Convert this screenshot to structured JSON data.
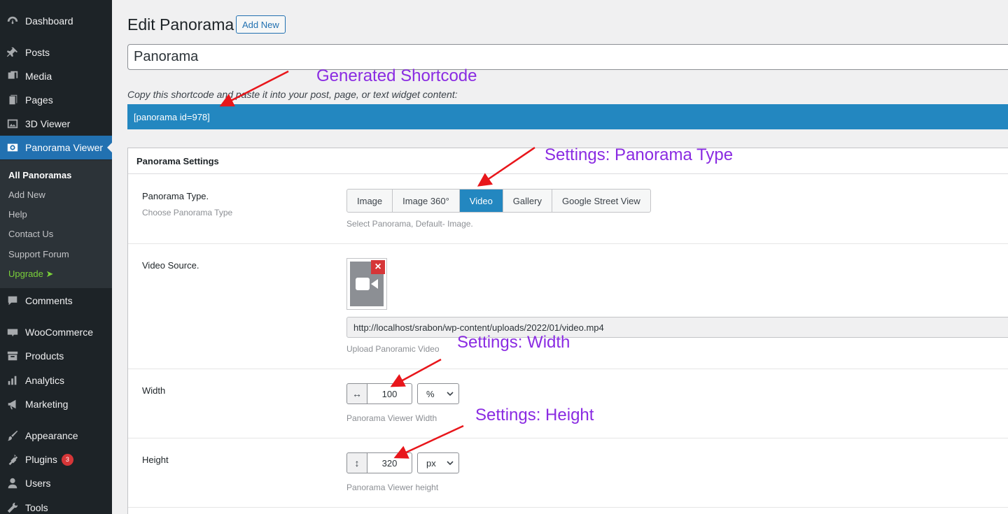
{
  "sidebar": {
    "items": [
      {
        "label": "Dashboard",
        "icon": "dashboard-icon"
      },
      {
        "label": "Posts",
        "icon": "pin-icon"
      },
      {
        "label": "Media",
        "icon": "media-icon"
      },
      {
        "label": "Pages",
        "icon": "pages-icon"
      },
      {
        "label": "3D Viewer",
        "icon": "image-icon"
      },
      {
        "label": "Panorama Viewer",
        "icon": "eye-icon"
      },
      {
        "label": "Comments",
        "icon": "comment-icon"
      },
      {
        "label": "WooCommerce",
        "icon": "woo-icon"
      },
      {
        "label": "Products",
        "icon": "archive-icon"
      },
      {
        "label": "Analytics",
        "icon": "chart-icon"
      },
      {
        "label": "Marketing",
        "icon": "megaphone-icon"
      },
      {
        "label": "Appearance",
        "icon": "brush-icon"
      },
      {
        "label": "Plugins",
        "icon": "plugin-icon",
        "badge": "3"
      },
      {
        "label": "Users",
        "icon": "user-icon"
      },
      {
        "label": "Tools",
        "icon": "wrench-icon"
      }
    ],
    "submenu": [
      "All Panoramas",
      "Add New",
      "Help",
      "Contact Us",
      "Support Forum",
      "Upgrade ➤"
    ]
  },
  "page": {
    "title": "Edit Panorama",
    "add_new": "Add New",
    "post_title": "Panorama",
    "copy_hint": "Copy this shortcode and paste it into your post, page, or text widget content:",
    "shortcode": "[panorama id=978]"
  },
  "settings": {
    "heading": "Panorama Settings",
    "type": {
      "label": "Panorama Type.",
      "desc": "Choose Panorama Type",
      "options": [
        "Image",
        "Image 360°",
        "Video",
        "Gallery",
        "Google Street View"
      ],
      "selected": "Video",
      "help": "Select Panorama, Default- Image."
    },
    "video": {
      "label": "Video Source.",
      "url": "http://localhost/srabon/wp-content/uploads/2022/01/video.mp4",
      "help": "Upload Panoramic Video"
    },
    "width": {
      "label": "Width",
      "value": "100",
      "unit": "%",
      "help": "Panorama Viewer Width"
    },
    "height": {
      "label": "Height",
      "value": "320",
      "unit": "px",
      "help": "Panorama Viewer height"
    }
  },
  "annotations": {
    "shortcode": "Generated Shortcode",
    "type": "Settings: Panorama Type",
    "width": "Settings: Width",
    "height": "Settings: Height"
  },
  "colors": {
    "accent": "#2271b1",
    "shortcode_bg": "#2387c0",
    "annotation": "#8a2be2",
    "arrow": "#e8161b"
  }
}
